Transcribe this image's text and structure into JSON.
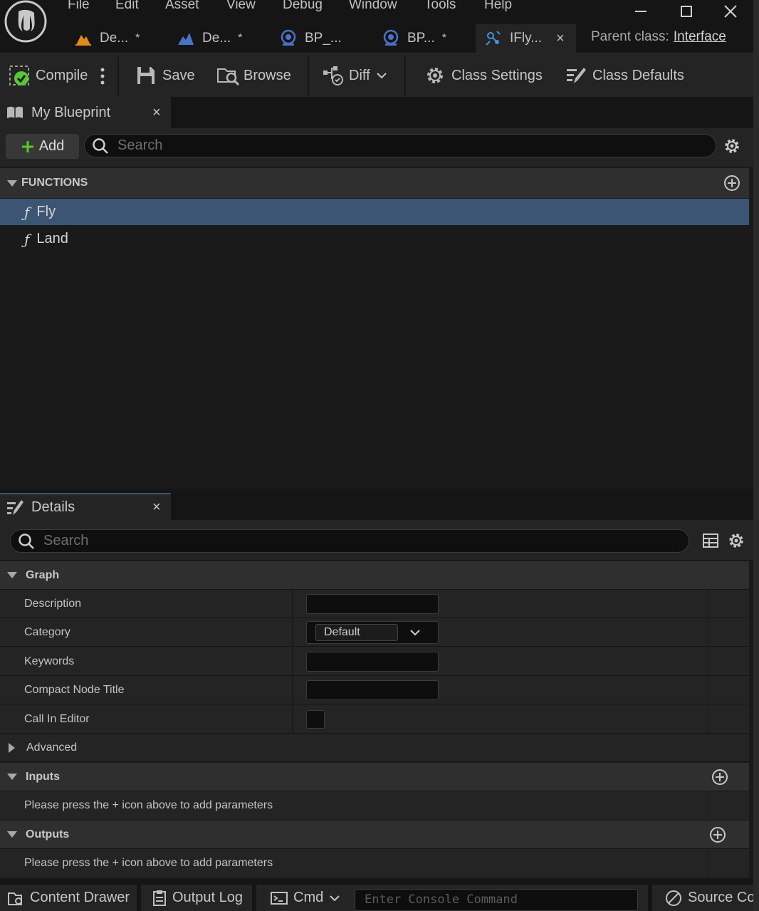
{
  "menu": [
    "File",
    "Edit",
    "Asset",
    "View",
    "Debug",
    "Window",
    "Tools",
    "Help"
  ],
  "tabs": [
    {
      "label": "De...",
      "dirty": "*",
      "icon": "level-icon"
    },
    {
      "label": "De...",
      "dirty": "*",
      "icon": "landscape-icon"
    },
    {
      "label": "BP_...",
      "dirty": "",
      "icon": "blueprint-icon"
    },
    {
      "label": "BP...",
      "dirty": "*",
      "icon": "blueprint-icon"
    },
    {
      "label": "IFly...",
      "dirty": "",
      "icon": "interface-icon",
      "active": true,
      "close": "×"
    }
  ],
  "parent_class": {
    "label": "Parent class:",
    "value": "Interface"
  },
  "toolbar": {
    "compile": "Compile",
    "save": "Save",
    "browse": "Browse",
    "diff": "Diff",
    "class_settings": "Class Settings",
    "class_defaults": "Class Defaults"
  },
  "my_blueprint": {
    "tab_label": "My Blueprint",
    "close": "×",
    "add_label": "Add",
    "search_placeholder": "Search",
    "functions_header": "FUNCTIONS",
    "functions": [
      {
        "glyph": "ƒ",
        "name": "Fly",
        "selected": true
      },
      {
        "glyph": "ƒ",
        "name": "Land",
        "selected": false
      }
    ]
  },
  "details": {
    "tab_label": "Details",
    "close": "×",
    "search_placeholder": "Search",
    "graph_header": "Graph",
    "properties": {
      "description": "Description",
      "category": "Category",
      "category_value": "Default",
      "keywords": "Keywords",
      "compact_title": "Compact Node Title",
      "call_in_editor": "Call In Editor"
    },
    "advanced_header": "Advanced",
    "inputs_header": "Inputs",
    "inputs_hint": "Please press the + icon above to add parameters",
    "outputs_header": "Outputs",
    "outputs_hint": "Please press the + icon above to add parameters"
  },
  "statusbar": {
    "content_drawer": "Content Drawer",
    "output_log": "Output Log",
    "cmd": "Cmd",
    "console_placeholder": "Enter Console Command",
    "source_control": "Source Control"
  },
  "colors": {
    "selection": "#3b5573",
    "accent_green": "#5ac634",
    "interface_blue": "#4a8fe0",
    "level_orange": "#e08a1c"
  }
}
